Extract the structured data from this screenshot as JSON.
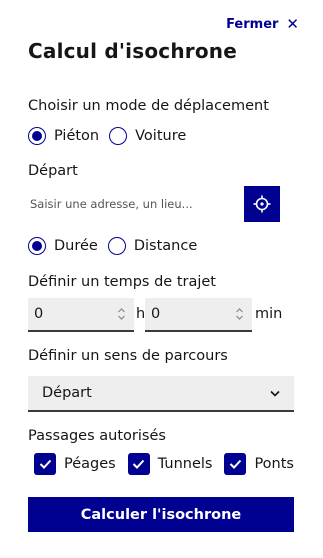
{
  "header": {
    "close_label": "Fermer",
    "close_icon": "close-icon",
    "title": "Calcul d'isochrone"
  },
  "mode": {
    "label": "Choisir un mode de déplacement",
    "options": [
      {
        "label": "Piéton",
        "checked": true
      },
      {
        "label": "Voiture",
        "checked": false
      }
    ]
  },
  "departure": {
    "label": "Départ",
    "placeholder": "Saisir une adresse, un lieu...",
    "value": "",
    "locate_icon": "crosshair-icon"
  },
  "calc_type": {
    "options": [
      {
        "label": "Durée",
        "checked": true
      },
      {
        "label": "Distance",
        "checked": false
      }
    ]
  },
  "duration": {
    "label": "Définir un temps de trajet",
    "hours": "0",
    "hours_unit": "h",
    "minutes": "0",
    "minutes_unit": "min"
  },
  "direction": {
    "label": "Définir un sens de parcours",
    "selected": "Départ"
  },
  "allowed": {
    "label": "Passages autorisés",
    "options": [
      {
        "label": "Péages",
        "checked": true
      },
      {
        "label": "Tunnels",
        "checked": true
      },
      {
        "label": "Ponts",
        "checked": true
      }
    ]
  },
  "submit_label": "Calculer l'isochrone",
  "colors": {
    "primary": "#000091",
    "field_bg": "#eeeeee",
    "text": "#161616"
  }
}
